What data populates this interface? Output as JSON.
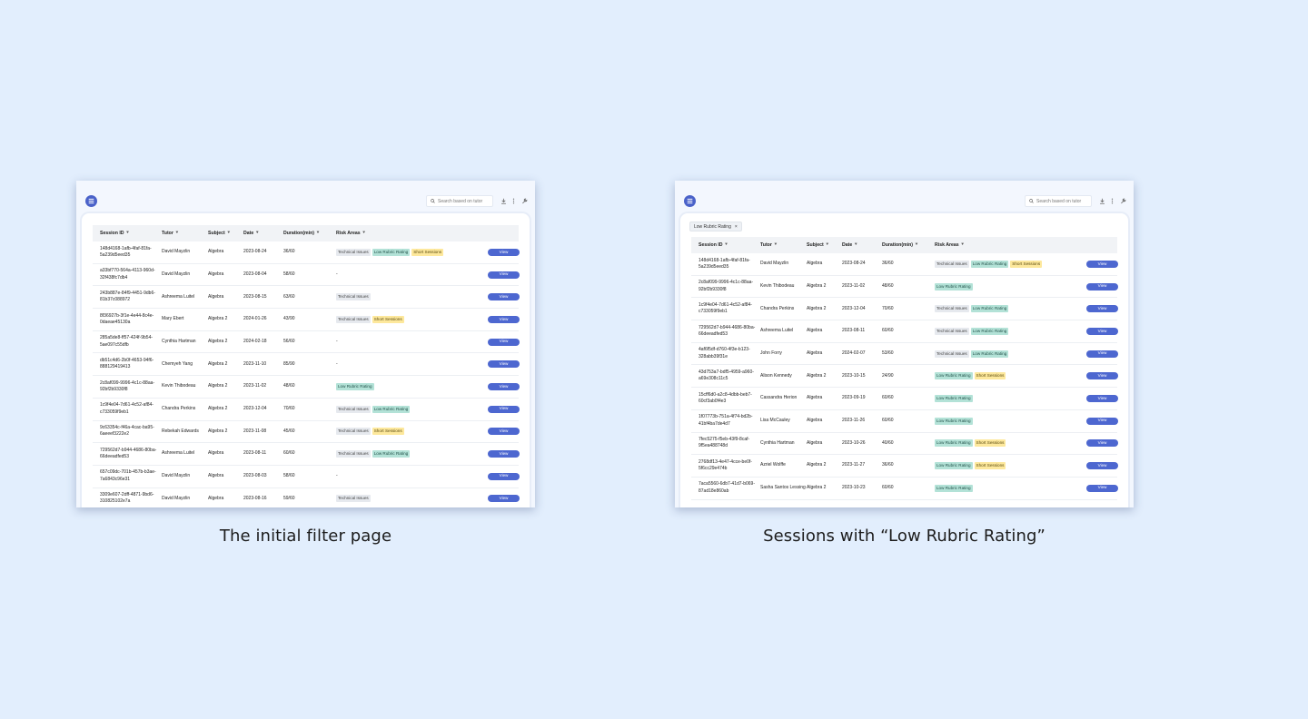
{
  "colors": {
    "background": "#e2eefd",
    "primary": "#4d67d0",
    "tag_technical": "#e6e9ee",
    "tag_low_rubric": "#b3e2d7",
    "tag_short_sessions": "#fde89c"
  },
  "icons": {
    "menu": "hamburger-menu-icon",
    "search": "magnifier-search-icon",
    "download": "download-icon",
    "more": "kebab-more-icon",
    "settings": "wrench-icon",
    "sort": "sort-arrow-icon",
    "chip_close": "close-x-icon"
  },
  "columns": [
    "Session ID",
    "Tutor",
    "Subject",
    "Date",
    "Duration(min)",
    "Risk Areas"
  ],
  "sort_glyph": "⯆",
  "search_placeholder": "Search based on tutor",
  "view_label": "View",
  "empty_risk": "-",
  "left": {
    "caption": "The initial filter page",
    "rows": [
      {
        "id": "148d4168-1afb-4faf-81fa-5a239d5eed35",
        "tutor": "David Mayzlin",
        "subject": "Algebra",
        "date": "2023-08-24",
        "duration": "36/60",
        "risks": [
          "Technical Issues",
          "Low Rubric Rating",
          "Short Sessions"
        ]
      },
      {
        "id": "a33bf770-564a-4113-960d-32f438fc7db4",
        "tutor": "David Mayzlin",
        "subject": "Algebra",
        "date": "2023-08-04",
        "duration": "58/60",
        "risks": []
      },
      {
        "id": "243b887e-84f9-4451-9db6-81b37c088972",
        "tutor": "Ashreema Luitel",
        "subject": "Algebra",
        "date": "2023-08-15",
        "duration": "63/60",
        "risks": [
          "Technical Issues"
        ]
      },
      {
        "id": "8f36927b-3f1e-4e44-8c4e-0daeae45130a",
        "tutor": "Mary Ebert",
        "subject": "Algebra 2",
        "date": "2024-01-26",
        "duration": "43/90",
        "risks": [
          "Technical Issues",
          "Short Sessions"
        ]
      },
      {
        "id": "285a5de8-ff57-424f-9b54-5ae097c55dfb",
        "tutor": "Cynthia Hartman",
        "subject": "Algebra 2",
        "date": "2024-02-18",
        "duration": "56/60",
        "risks": []
      },
      {
        "id": "db51c4d6-2b0f-4653-94f6-888129419413",
        "tutor": "Chemyeh Yang",
        "subject": "Algebra 2",
        "date": "2023-11-10",
        "duration": "85/90",
        "risks": []
      },
      {
        "id": "2c8af099-9996-4c1c-88aa-92bf2b9330f8",
        "tutor": "Kevin Thibodeau",
        "subject": "Algebra 2",
        "date": "2023-11-02",
        "duration": "48/60",
        "risks": [
          "Low Rubric Rating"
        ]
      },
      {
        "id": "1c9f4e04-7d61-4c52-af84-c733059f9eb1",
        "tutor": "Chandra Perkins",
        "subject": "Algebra 2",
        "date": "2023-12-04",
        "duration": "70/60",
        "risks": [
          "Technical Issues",
          "Low Rubric Rating"
        ]
      },
      {
        "id": "9c63354c-f46a-4cac-ba95-6aeeef3222e2",
        "tutor": "Rebekah Edwards",
        "subject": "Algebra 2",
        "date": "2023-11-08",
        "duration": "45/60",
        "risks": [
          "Technical Issues",
          "Short Sessions"
        ]
      },
      {
        "id": "729562d7-b944-4686-80ba-66deeadfed53",
        "tutor": "Ashreema Luitel",
        "subject": "Algebra",
        "date": "2023-08-11",
        "duration": "60/60",
        "risks": [
          "Technical Issues",
          "Low Rubric Rating"
        ]
      },
      {
        "id": "657c09dc-701b-457b-b3ae-7a6843c96e31",
        "tutor": "David Mayzlin",
        "subject": "Algebra",
        "date": "2023-08-03",
        "duration": "58/60",
        "risks": []
      },
      {
        "id": "3309e607-2dff-4871-9bd6-310825102e7a",
        "tutor": "David Mayzlin",
        "subject": "Algebra",
        "date": "2023-08-16",
        "duration": "59/60",
        "risks": [
          "Technical Issues"
        ]
      }
    ]
  },
  "right": {
    "caption": "Sessions with “Low Rubric Rating”",
    "filter_chip": "Low Rubric Rating",
    "rows": [
      {
        "id": "148d4168-1afb-4faf-81fa-5a239d5eed35",
        "tutor": "David Mayzlin",
        "subject": "Algebra",
        "date": "2023-08-24",
        "duration": "36/60",
        "risks": [
          "Technical Issues",
          "Low Rubric Rating",
          "Short Sessions"
        ]
      },
      {
        "id": "2c8af099-9996-4c1c-88aa-92bf2b9330f8",
        "tutor": "Kevin Thibodeau",
        "subject": "Algebra 2",
        "date": "2023-11-02",
        "duration": "48/60",
        "risks": [
          "Low Rubric Rating"
        ]
      },
      {
        "id": "1c9f4e04-7d61-4c52-af84-c733059f9eb1",
        "tutor": "Chandra Perkins",
        "subject": "Algebra 2",
        "date": "2023-12-04",
        "duration": "70/60",
        "risks": [
          "Technical Issues",
          "Low Rubric Rating"
        ]
      },
      {
        "id": "729562d7-b944-4686-80ba-66deeadfed53",
        "tutor": "Ashreema Luitel",
        "subject": "Algebra",
        "date": "2023-08-11",
        "duration": "60/60",
        "risks": [
          "Technical Issues",
          "Low Rubric Rating"
        ]
      },
      {
        "id": "4af6f5df-d760-4f3e-b123-328abb39f31e",
        "tutor": "John Forry",
        "subject": "Algebra",
        "date": "2024-02-07",
        "duration": "53/60",
        "risks": [
          "Technical Issues",
          "Low Rubric Rating"
        ]
      },
      {
        "id": "43d753a7-bdf5-4959-a960-a69e308c11c5",
        "tutor": "Alison Kennedy",
        "subject": "Algebra 2",
        "date": "2023-10-15",
        "duration": "24/90",
        "risks": [
          "Low Rubric Rating",
          "Short Sessions"
        ]
      },
      {
        "id": "15cff6d0-a2c8-4dbb-beb7-60cf3ab0f4e3",
        "tutor": "Cassandra Herion",
        "subject": "Algebra",
        "date": "2023-09-19",
        "duration": "60/60",
        "risks": [
          "Low Rubric Rating"
        ]
      },
      {
        "id": "1f07773b-751a-4f74-bd2b-41bf4ba7de4d7",
        "tutor": "Lisa McCauley",
        "subject": "Algebra",
        "date": "2023-11-26",
        "duration": "60/60",
        "risks": [
          "Low Rubric Rating"
        ]
      },
      {
        "id": "7fec5275-f5eb-43f9-8caf-9f5ea488748d",
        "tutor": "Cynthia Hartman",
        "subject": "Algebra",
        "date": "2023-10-26",
        "duration": "40/60",
        "risks": [
          "Low Rubric Rating",
          "Short Sessions"
        ]
      },
      {
        "id": "2768df13-4e47-4cce-be0f-5f6cc29e474b",
        "tutor": "Azriel Wolffe",
        "subject": "Algebra 2",
        "date": "2023-11-27",
        "duration": "36/60",
        "risks": [
          "Low Rubric Rating",
          "Short Sessions"
        ]
      },
      {
        "id": "7aca5560-6db7-41d7-b069-87ad18e860ab",
        "tutor": "Sasha Santos Lessing",
        "subject": "Algebra 2",
        "date": "2023-10-23",
        "duration": "60/60",
        "risks": [
          "Low Rubric Rating"
        ]
      }
    ]
  }
}
